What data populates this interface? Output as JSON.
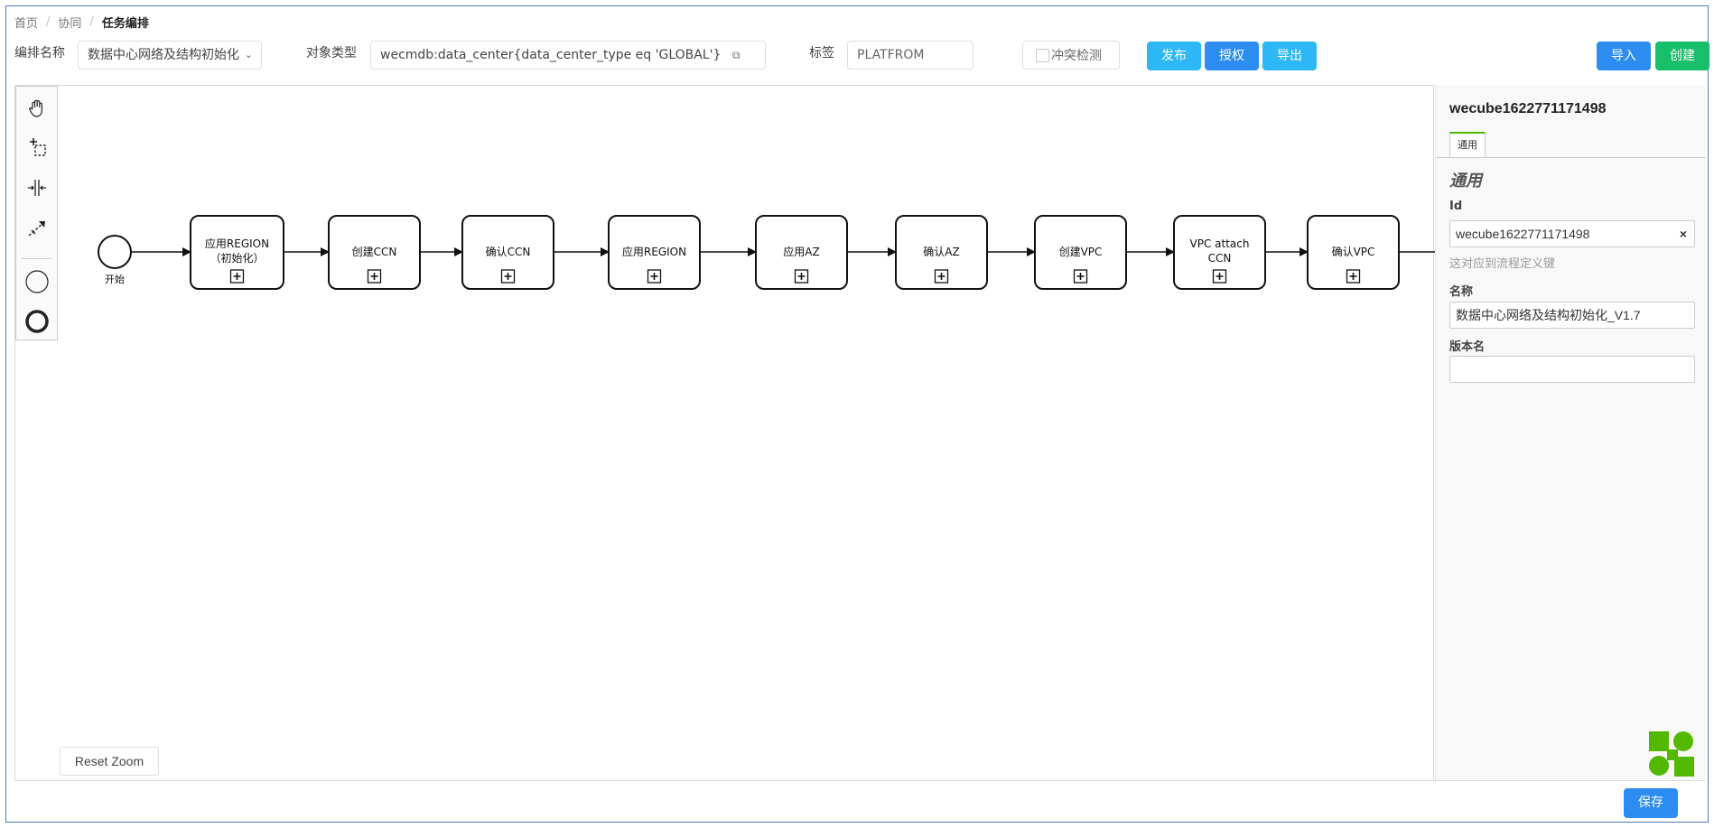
{
  "breadcrumb": {
    "home": "首页",
    "sep": "/",
    "collab": "协同",
    "current": "任务编排"
  },
  "header": {
    "orch_name_label": "编排名称",
    "orch_name_value": "数据中心网络及结构初始化",
    "object_type_label": "对象类型",
    "object_type_value": "wecmdb:data_center{data_center_type eq 'GLOBAL'}",
    "tag_label": "标签",
    "tag_value": "PLATFROM",
    "conflict_check_label": "冲突检测",
    "publish_label": "发布",
    "authorize_label": "授权",
    "export_label": "导出",
    "import_label": "导入",
    "create_label": "创建"
  },
  "palette": [
    "hand-tool",
    "lasso-tool",
    "space-tool",
    "connect-tool",
    "start-event",
    "end-event"
  ],
  "diagram": {
    "start_label": "开始",
    "tasks": [
      {
        "line1": "应用REGION",
        "line2": "（初始化）"
      },
      {
        "line1": "创建CCN",
        "line2": ""
      },
      {
        "line1": "确认CCN",
        "line2": ""
      },
      {
        "line1": "应用REGION",
        "line2": ""
      },
      {
        "line1": "应用AZ",
        "line2": ""
      },
      {
        "line1": "确认AZ",
        "line2": ""
      },
      {
        "line1": "创建VPC",
        "line2": ""
      },
      {
        "line1": "VPC attach",
        "line2": "CCN"
      },
      {
        "line1": "确认VPC",
        "line2": ""
      }
    ],
    "reset_zoom": "Reset Zoom"
  },
  "panel": {
    "title": "wecube1622771171498",
    "tab_label": "通用",
    "group_title": "通用",
    "id_label": "Id",
    "id_value": "wecube1622771171498",
    "id_clear": "×",
    "id_hint": "这对应到流程定义键",
    "name_label": "名称",
    "name_value": "数据中心网络及结构初始化_V1.7",
    "version_label": "版本名",
    "version_value": ""
  },
  "footer": {
    "save_label": "保存"
  },
  "colors": {
    "primary": "#2d8cf0",
    "info": "#2db7f5",
    "success": "#19be6b",
    "logo": "#52b800"
  }
}
